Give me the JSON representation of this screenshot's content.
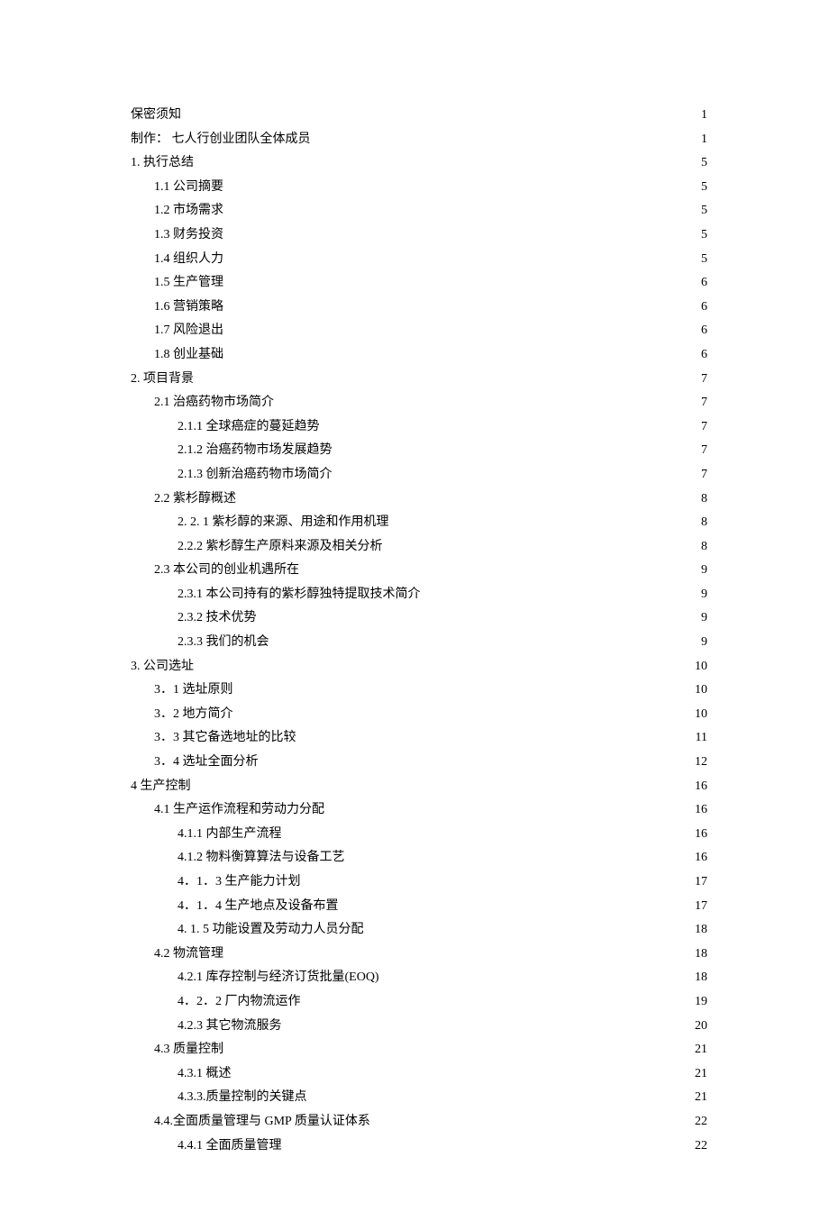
{
  "toc": [
    {
      "label": "保密须知",
      "page": "1",
      "indent": 0,
      "sparse": true
    },
    {
      "label": "制作：  七人行创业团队全体成员",
      "page": "1",
      "indent": 0,
      "sparse": true
    },
    {
      "label": "1. 执行总结",
      "page": "5",
      "indent": 0,
      "sparse": true
    },
    {
      "label": "1.1 公司摘要 ",
      "page": "5",
      "indent": 1,
      "sparse": false
    },
    {
      "label": "1.2 市场需求 ",
      "page": "5",
      "indent": 1,
      "sparse": false
    },
    {
      "label": "1.3 财务投资 ",
      "page": "5",
      "indent": 1,
      "sparse": false
    },
    {
      "label": "1.4 组织人力 ",
      "page": "5",
      "indent": 1,
      "sparse": false
    },
    {
      "label": "1.5 生产管理 ",
      "page": "6",
      "indent": 1,
      "sparse": false
    },
    {
      "label": "1.6 营销策略 ",
      "page": "6",
      "indent": 1,
      "sparse": false
    },
    {
      "label": "1.7 风险退出 ",
      "page": "6",
      "indent": 1,
      "sparse": false
    },
    {
      "label": "1.8 创业基础 ",
      "page": "6",
      "indent": 1,
      "sparse": false
    },
    {
      "label": "2.  项目背景",
      "page": "7",
      "indent": 0,
      "sparse": true
    },
    {
      "label": "2.1 治癌药物市场简介 ",
      "page": "7",
      "indent": 1,
      "sparse": false
    },
    {
      "label": "2.1.1 全球癌症的蔓延趋势 ",
      "page": "7",
      "indent": 2,
      "sparse": false
    },
    {
      "label": "2.1.2 治癌药物市场发展趋势 ",
      "page": "7",
      "indent": 2,
      "sparse": false
    },
    {
      "label": "2.1.3 创新治癌药物市场简介 ",
      "page": "7",
      "indent": 2,
      "sparse": false
    },
    {
      "label": "2.2 紫杉醇概述 ",
      "page": "8",
      "indent": 1,
      "sparse": false
    },
    {
      "label": "2. 2. 1 紫杉醇的来源、用途和作用机理 ",
      "page": "8",
      "indent": 2,
      "sparse": false
    },
    {
      "label": "2.2.2 紫杉醇生产原料来源及相关分析 ",
      "page": "8",
      "indent": 2,
      "sparse": false
    },
    {
      "label": "2.3 本公司的创业机遇所在 ",
      "page": "9",
      "indent": 1,
      "sparse": false
    },
    {
      "label": "2.3.1 本公司持有的紫杉醇独特提取技术简介 ",
      "page": "9",
      "indent": 2,
      "sparse": false
    },
    {
      "label": "2.3.2 技术优势 ",
      "page": "9",
      "indent": 2,
      "sparse": false
    },
    {
      "label": "2.3.3 我们的机会 ",
      "page": "9",
      "indent": 2,
      "sparse": false
    },
    {
      "label": "3.  公司选址",
      "page": "10",
      "indent": 0,
      "sparse": true
    },
    {
      "label": "3．1 选址原则 ",
      "page": "10",
      "indent": 1,
      "sparse": false
    },
    {
      "label": "3．2 地方简介 ",
      "page": "10",
      "indent": 1,
      "sparse": false
    },
    {
      "label": "3．3 其它备选地址的比较 ",
      "page": "11",
      "indent": 1,
      "sparse": false
    },
    {
      "label": "3．4 选址全面分析 ",
      "page": "12",
      "indent": 1,
      "sparse": false
    },
    {
      "label": "4 生产控制 ",
      "page": "16",
      "indent": 0,
      "sparse": true
    },
    {
      "label": "4.1 生产运作流程和劳动力分配 ",
      "page": "16",
      "indent": 1,
      "sparse": false
    },
    {
      "label": "4.1.1 内部生产流程 ",
      "page": "16",
      "indent": 2,
      "sparse": false
    },
    {
      "label": "4.1.2   物料衡算算法与设备工艺 ",
      "page": "16",
      "indent": 2,
      "sparse": false
    },
    {
      "label": "4．1．3   生产能力计划 ",
      "page": "17",
      "indent": 2,
      "sparse": false
    },
    {
      "label": "4．1．4   生产地点及设备布置 ",
      "page": "17",
      "indent": 2,
      "sparse": false
    },
    {
      "label": "4. 1. 5 功能设置及劳动力人员分配 ",
      "page": "18",
      "indent": 2,
      "sparse": false
    },
    {
      "label": "4.2 物流管理 ",
      "page": "18",
      "indent": 1,
      "sparse": false
    },
    {
      "label": "4.2.1 库存控制与经济订货批量(EOQ) ",
      "page": "18",
      "indent": 2,
      "sparse": false
    },
    {
      "label": "4．2．2   厂内物流运作 ",
      "page": "19",
      "indent": 2,
      "sparse": false
    },
    {
      "label": "4.2.3 其它物流服务 ",
      "page": "20",
      "indent": 2,
      "sparse": false
    },
    {
      "label": "4.3 质量控制 ",
      "page": "21",
      "indent": 1,
      "sparse": false
    },
    {
      "label": "4.3.1 概述 ",
      "page": "21",
      "indent": 2,
      "sparse": false
    },
    {
      "label": "4.3.3.质量控制的关键点 ",
      "page": "21",
      "indent": 2,
      "sparse": false
    },
    {
      "label": "4.4.全面质量管理与 GMP 质量认证体系",
      "page": "22",
      "indent": 1,
      "sparse": false
    },
    {
      "label": "4.4.1 全面质量管理 ",
      "page": "22",
      "indent": 2,
      "sparse": false
    }
  ]
}
